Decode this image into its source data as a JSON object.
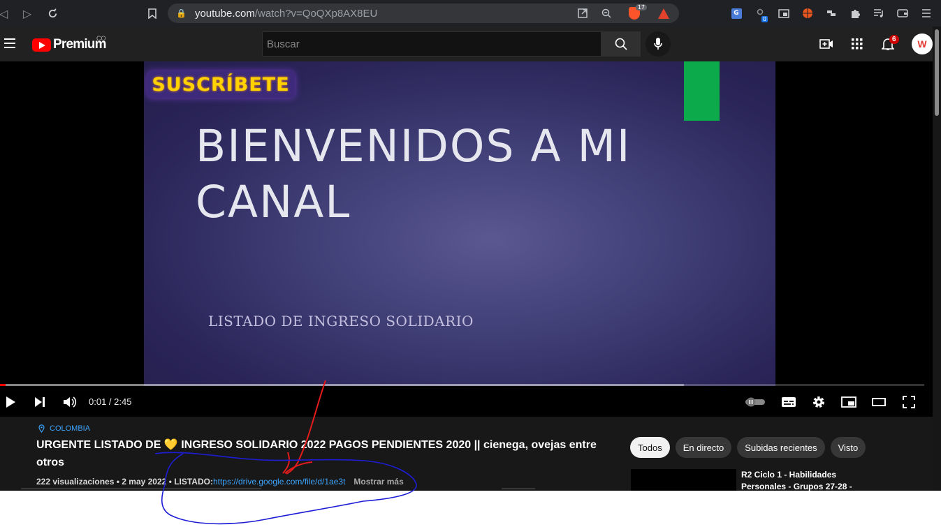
{
  "browser": {
    "url_host": "youtube.com",
    "url_path": "/watch?v=QoQXp8AX8EU",
    "brave_shield_count": "17",
    "ext_badge": "0",
    "icons": [
      "back-icon",
      "forward-icon",
      "reload-icon",
      "bookmark-icon",
      "lock-icon",
      "share-icon",
      "zoom-icon",
      "brave-shield-icon",
      "bat-rewards-icon",
      "translate-icon",
      "extension-icon",
      "pip-icon",
      "extension-icon",
      "extension-icon",
      "puzzle-icon",
      "playlist-icon",
      "wallet-icon",
      "menu-icon"
    ]
  },
  "masthead": {
    "logo_text": "Premium",
    "country": "CO",
    "search_placeholder": "Buscar",
    "notifications_count": "6",
    "avatar_letter": "W"
  },
  "video": {
    "subscribe_banner": "SUSCRÍBETE",
    "slide_title": "BIENVENIDOS A MI CANAL",
    "slide_subtitle": "LISTADO DE INGRESO SOLIDARIO",
    "time": "0:01 / 2:45",
    "progress_played": 0.006,
    "progress_buffered": 0.74
  },
  "details": {
    "location": "COLOMBIA",
    "title_part1": "URGENTE LISTADO DE ",
    "heart": "💛",
    "title_part2": " INGRESO SOLIDARIO 2022 PAGOS PENDIENTES 2020 || cienega, ovejas entre otros",
    "meta": "222 visualizaciones • 2 may 2022 • LISTADO:",
    "link": "https://drive.google.com/file/d/1ae3t",
    "more": "Mostrar más"
  },
  "chips": [
    "Todos",
    "En directo",
    "Subidas recientes",
    "Visto"
  ],
  "recommendation": {
    "title": "R2 Ciclo 1 - Habilidades Personales - Grupos 27-28 -"
  },
  "colors": {
    "accent_red": "#ff0000",
    "link_blue": "#3ea6ff",
    "annotation_blue": "#1d1dd6",
    "annotation_red": "#e31b1b"
  }
}
